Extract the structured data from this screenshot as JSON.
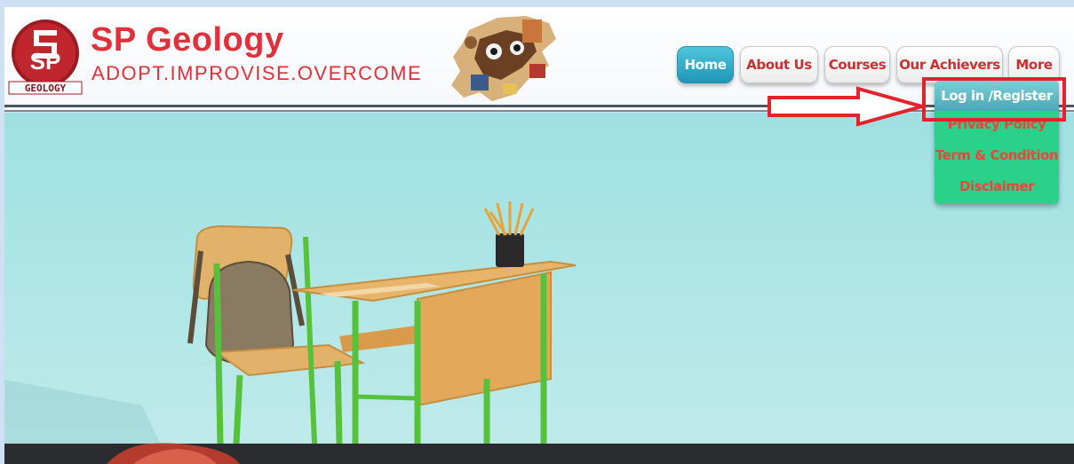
{
  "brand": {
    "name": "SP Geology",
    "tagline": "ADOPT.IMPROVISE.OVERCOME",
    "badge_letters": "SP",
    "badge_word": "GEOLOGY"
  },
  "nav": {
    "items": [
      {
        "label": "Home",
        "active": true
      },
      {
        "label": "About Us",
        "active": false
      },
      {
        "label": "Courses",
        "active": false
      },
      {
        "label": "Our Achievers",
        "active": false
      },
      {
        "label": "More",
        "active": false
      }
    ]
  },
  "dropdown": {
    "items": [
      {
        "label": "Log in /Register",
        "highlighted": true
      },
      {
        "label": "Privacy Policy",
        "highlighted": false
      },
      {
        "label": "Term & Condition",
        "highlighted": false
      },
      {
        "label": "Disclaimer",
        "highlighted": false
      }
    ]
  },
  "colors": {
    "brand_red": "#e0303a",
    "nav_active": "#1f97b8",
    "dropdown_bg": "#2bd08a",
    "annotation_red": "#e3232c"
  }
}
